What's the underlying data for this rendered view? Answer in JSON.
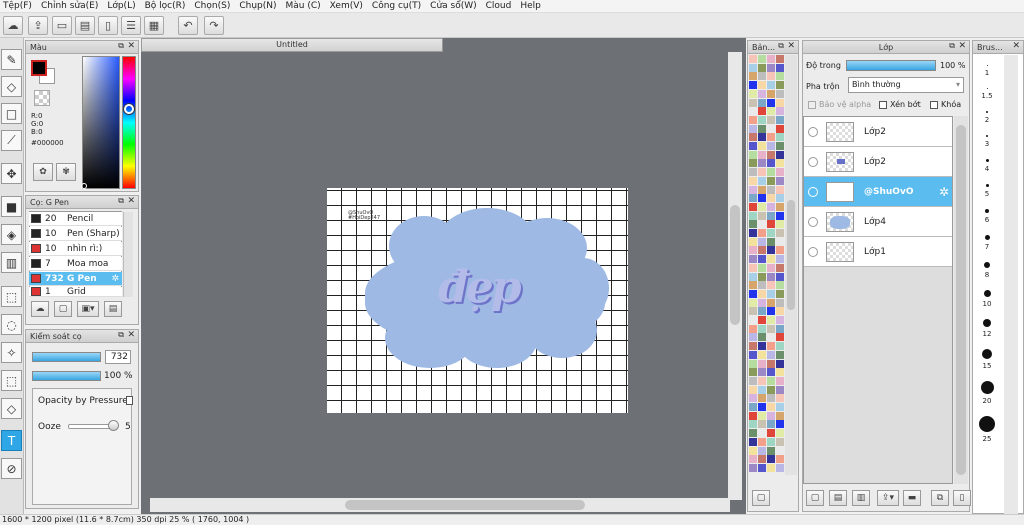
{
  "menu": [
    "Tệp(F)",
    "Chỉnh sửa(E)",
    "Lớp(L)",
    "Bộ lọc(R)",
    "Chọn(S)",
    "Chụp(N)",
    "Màu (C)",
    "Xem(V)",
    "Công cụ(T)",
    "Cửa sổ(W)",
    "Cloud",
    "Help"
  ],
  "document": {
    "tab_title": "Untitled"
  },
  "canvas_text": {
    "art_word": "đẹp",
    "watermark_line1": "@ShuOvO",
    "watermark_line2": "#HoiDep247"
  },
  "color_panel": {
    "title": "Màu",
    "r": "R:0",
    "g": "G:0",
    "b": "B:0",
    "hex": "#000000",
    "fg_color": "#000000"
  },
  "brush_panel": {
    "title": "Cọ: G Pen",
    "items": [
      {
        "size": "20",
        "name": "Pencil",
        "color": "#222222"
      },
      {
        "size": "10",
        "name": "Pen (Sharp)",
        "color": "#222222"
      },
      {
        "size": "10",
        "name": "nhìn rì:)",
        "color": "#d33333"
      },
      {
        "size": "7",
        "name": "Moa moa",
        "color": "#222222"
      },
      {
        "size": "732",
        "name": "G Pen",
        "color": "#d33333"
      },
      {
        "size": "1",
        "name": "Grid",
        "color": "#d33333"
      }
    ]
  },
  "brush_control": {
    "title": "Kiểm soát cọ",
    "size_value": "732",
    "opacity_value": "100 %",
    "opacity_by_pressure": "Opacity by Pressure",
    "ooze_label": "Ooze",
    "ooze_value": "5"
  },
  "palette_panel": {
    "title": "Bản..."
  },
  "layer_panel": {
    "title": "Lớp",
    "opacity_label": "Độ trong",
    "opacity_value": "100 %",
    "blend_label": "Pha trộn",
    "blend_value": "Bình thường",
    "protect_alpha": "Bảo vệ alpha",
    "clipping": "Xén bớt",
    "lock": "Khóa",
    "layers": [
      {
        "name": "Lớp2",
        "selected": false
      },
      {
        "name": "Lớp2",
        "selected": false
      },
      {
        "name": "@ShuOvO",
        "selected": true
      },
      {
        "name": "Lớp4",
        "selected": false
      },
      {
        "name": "Lớp1",
        "selected": false
      }
    ]
  },
  "brush_size_panel": {
    "title": "Brus...",
    "sizes": [
      "1",
      "1.5",
      "2",
      "3",
      "4",
      "5",
      "6",
      "7",
      "8",
      "10",
      "12",
      "15",
      "20",
      "25"
    ]
  },
  "status": {
    "text": "1600 * 1200 pixel   (11.6 * 8.7cm)   350 dpi   25 %   ( 1760, 1004 )"
  },
  "colors": {
    "accent": "#5bbcef",
    "cloud": "#9db9e4",
    "canvas_bg": "#6d7075"
  }
}
